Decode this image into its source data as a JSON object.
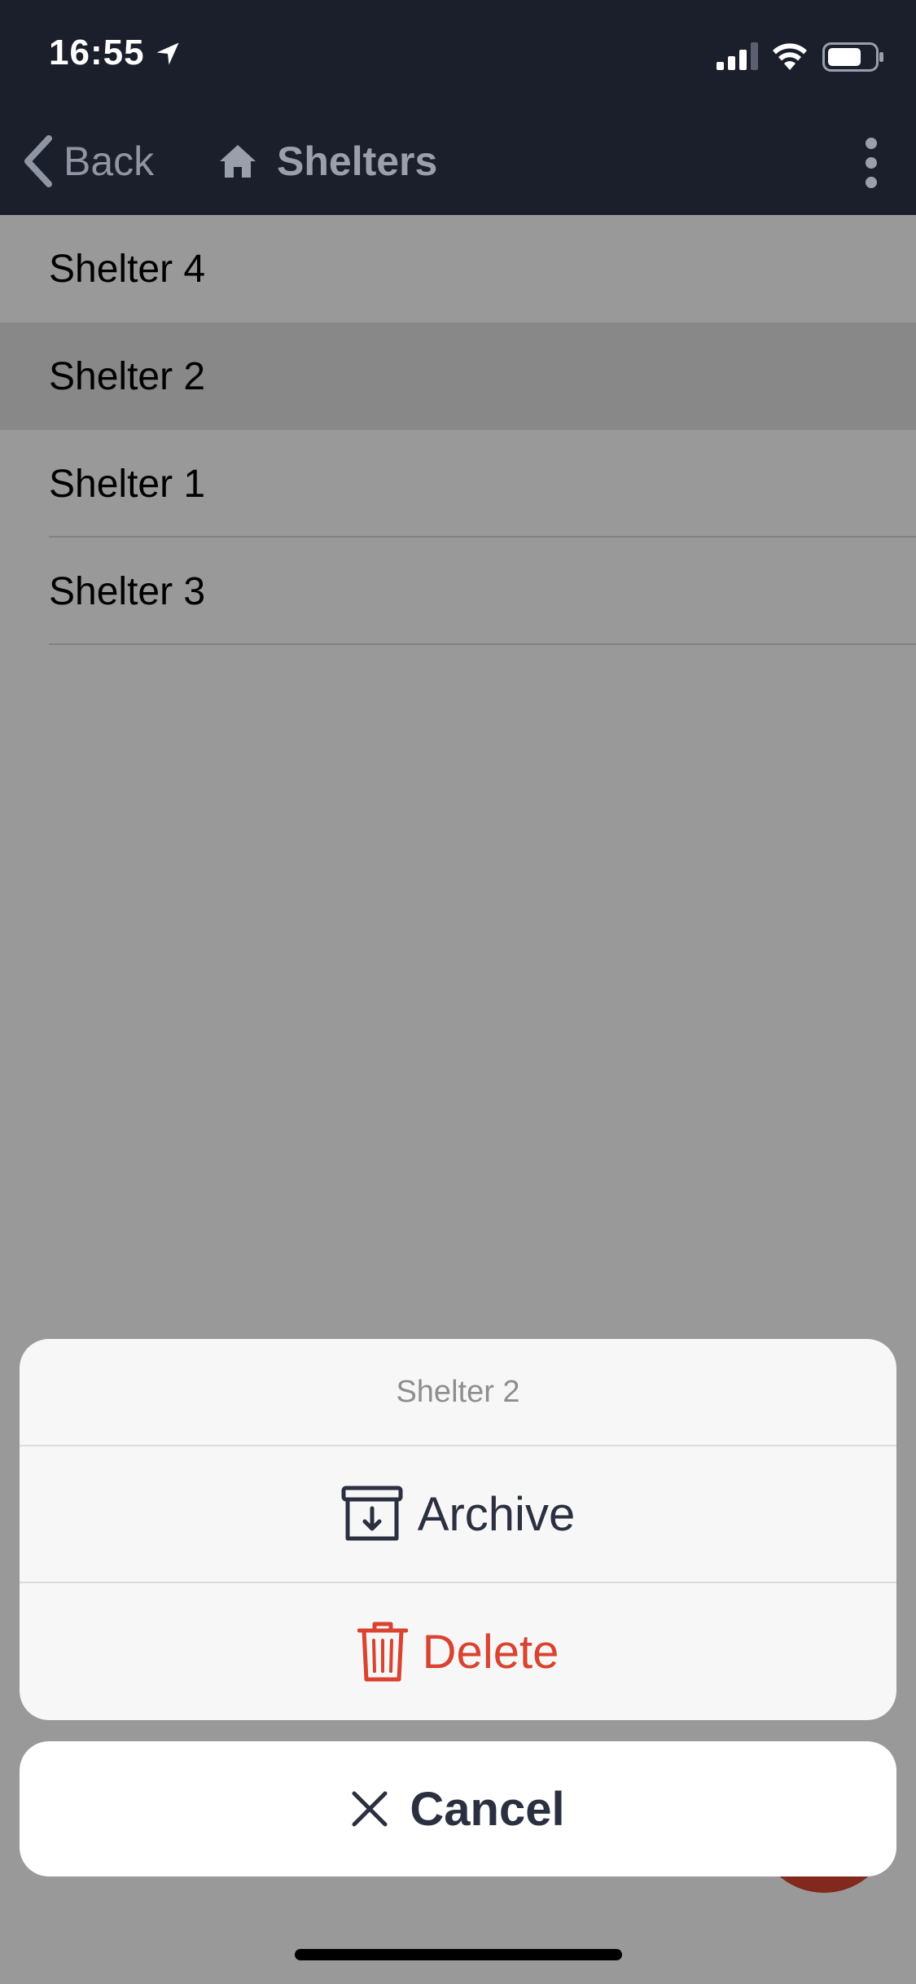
{
  "status_bar": {
    "time": "16:55",
    "icons": [
      "location-arrow-icon",
      "cellular-signal-icon",
      "wifi-icon",
      "battery-icon"
    ]
  },
  "nav": {
    "back_label": "Back",
    "title": "Shelters",
    "title_icon": "home-icon",
    "more_icon": "more-vertical-icon"
  },
  "list": {
    "items": [
      {
        "label": "Shelter 4"
      },
      {
        "label": "Shelter 2"
      },
      {
        "label": "Shelter 1"
      },
      {
        "label": "Shelter 3"
      }
    ]
  },
  "action_sheet": {
    "title": "Shelter 2",
    "archive_label": "Archive",
    "archive_icon": "archive-box-icon",
    "delete_label": "Delete",
    "delete_icon": "trash-icon",
    "cancel_label": "Cancel",
    "cancel_icon": "close-icon"
  },
  "fab_icon": "plus-icon",
  "colors": {
    "nav_background": "#1b1f2b",
    "accent_red": "#d9432f",
    "dark_text": "#2b3040"
  }
}
